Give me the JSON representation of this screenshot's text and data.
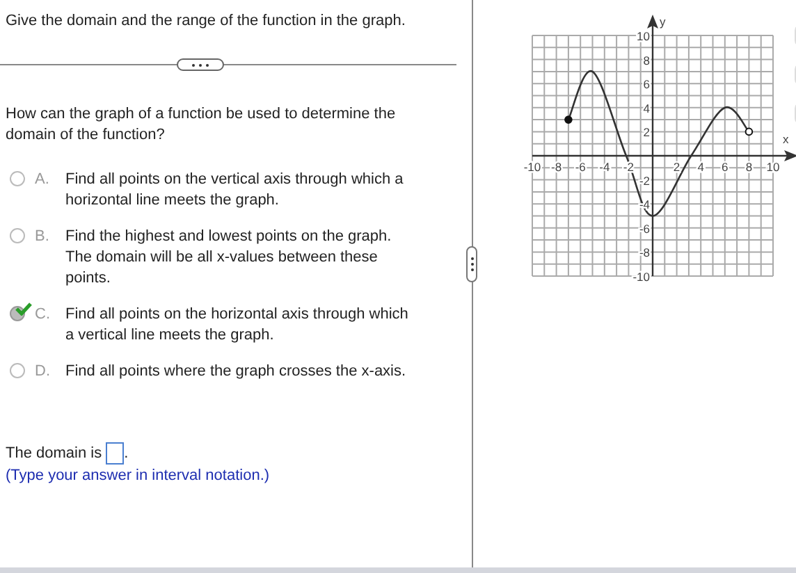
{
  "instruction": "Give the domain and the range of the function in the graph.",
  "question": "How can the graph of a function be used to determine the domain of the function?",
  "options": [
    {
      "letter": "A.",
      "text": "Find all points on the vertical axis through which a horizontal line meets the graph.",
      "selected": false
    },
    {
      "letter": "B.",
      "text": "Find the highest and lowest points on the graph. The domain will be all x-values between these points.",
      "selected": false
    },
    {
      "letter": "C.",
      "text": "Find all points on the horizontal axis through which a vertical line meets the graph.",
      "selected": true
    },
    {
      "letter": "D.",
      "text": "Find all points where the graph crosses the x-axis.",
      "selected": false
    }
  ],
  "answer": {
    "prefix": "The domain is",
    "suffix": ".",
    "hint": "(Type your answer in interval notation.)"
  },
  "graph": {
    "endpoints": [
      {
        "filled": true
      },
      {
        "filled": false
      }
    ],
    "chart_data": {
      "type": "line",
      "xlabel": "x",
      "ylabel": "y",
      "x": [
        -7,
        -5,
        -2.2,
        0,
        3.2,
        6,
        8
      ],
      "grid": true,
      "series": [
        {
          "color": "#333333",
          "values": [
            3,
            7,
            0,
            -5,
            0,
            4,
            2
          ]
        }
      ],
      "xlim": [
        -10,
        10
      ],
      "ylim": [
        -10,
        10
      ],
      "xticks": [
        -10,
        -8,
        -6,
        -4,
        -2,
        2,
        4,
        6,
        8,
        10
      ],
      "yticks": [
        -10,
        -8,
        -6,
        -4,
        -2,
        2,
        4,
        6,
        8,
        10
      ]
    }
  }
}
